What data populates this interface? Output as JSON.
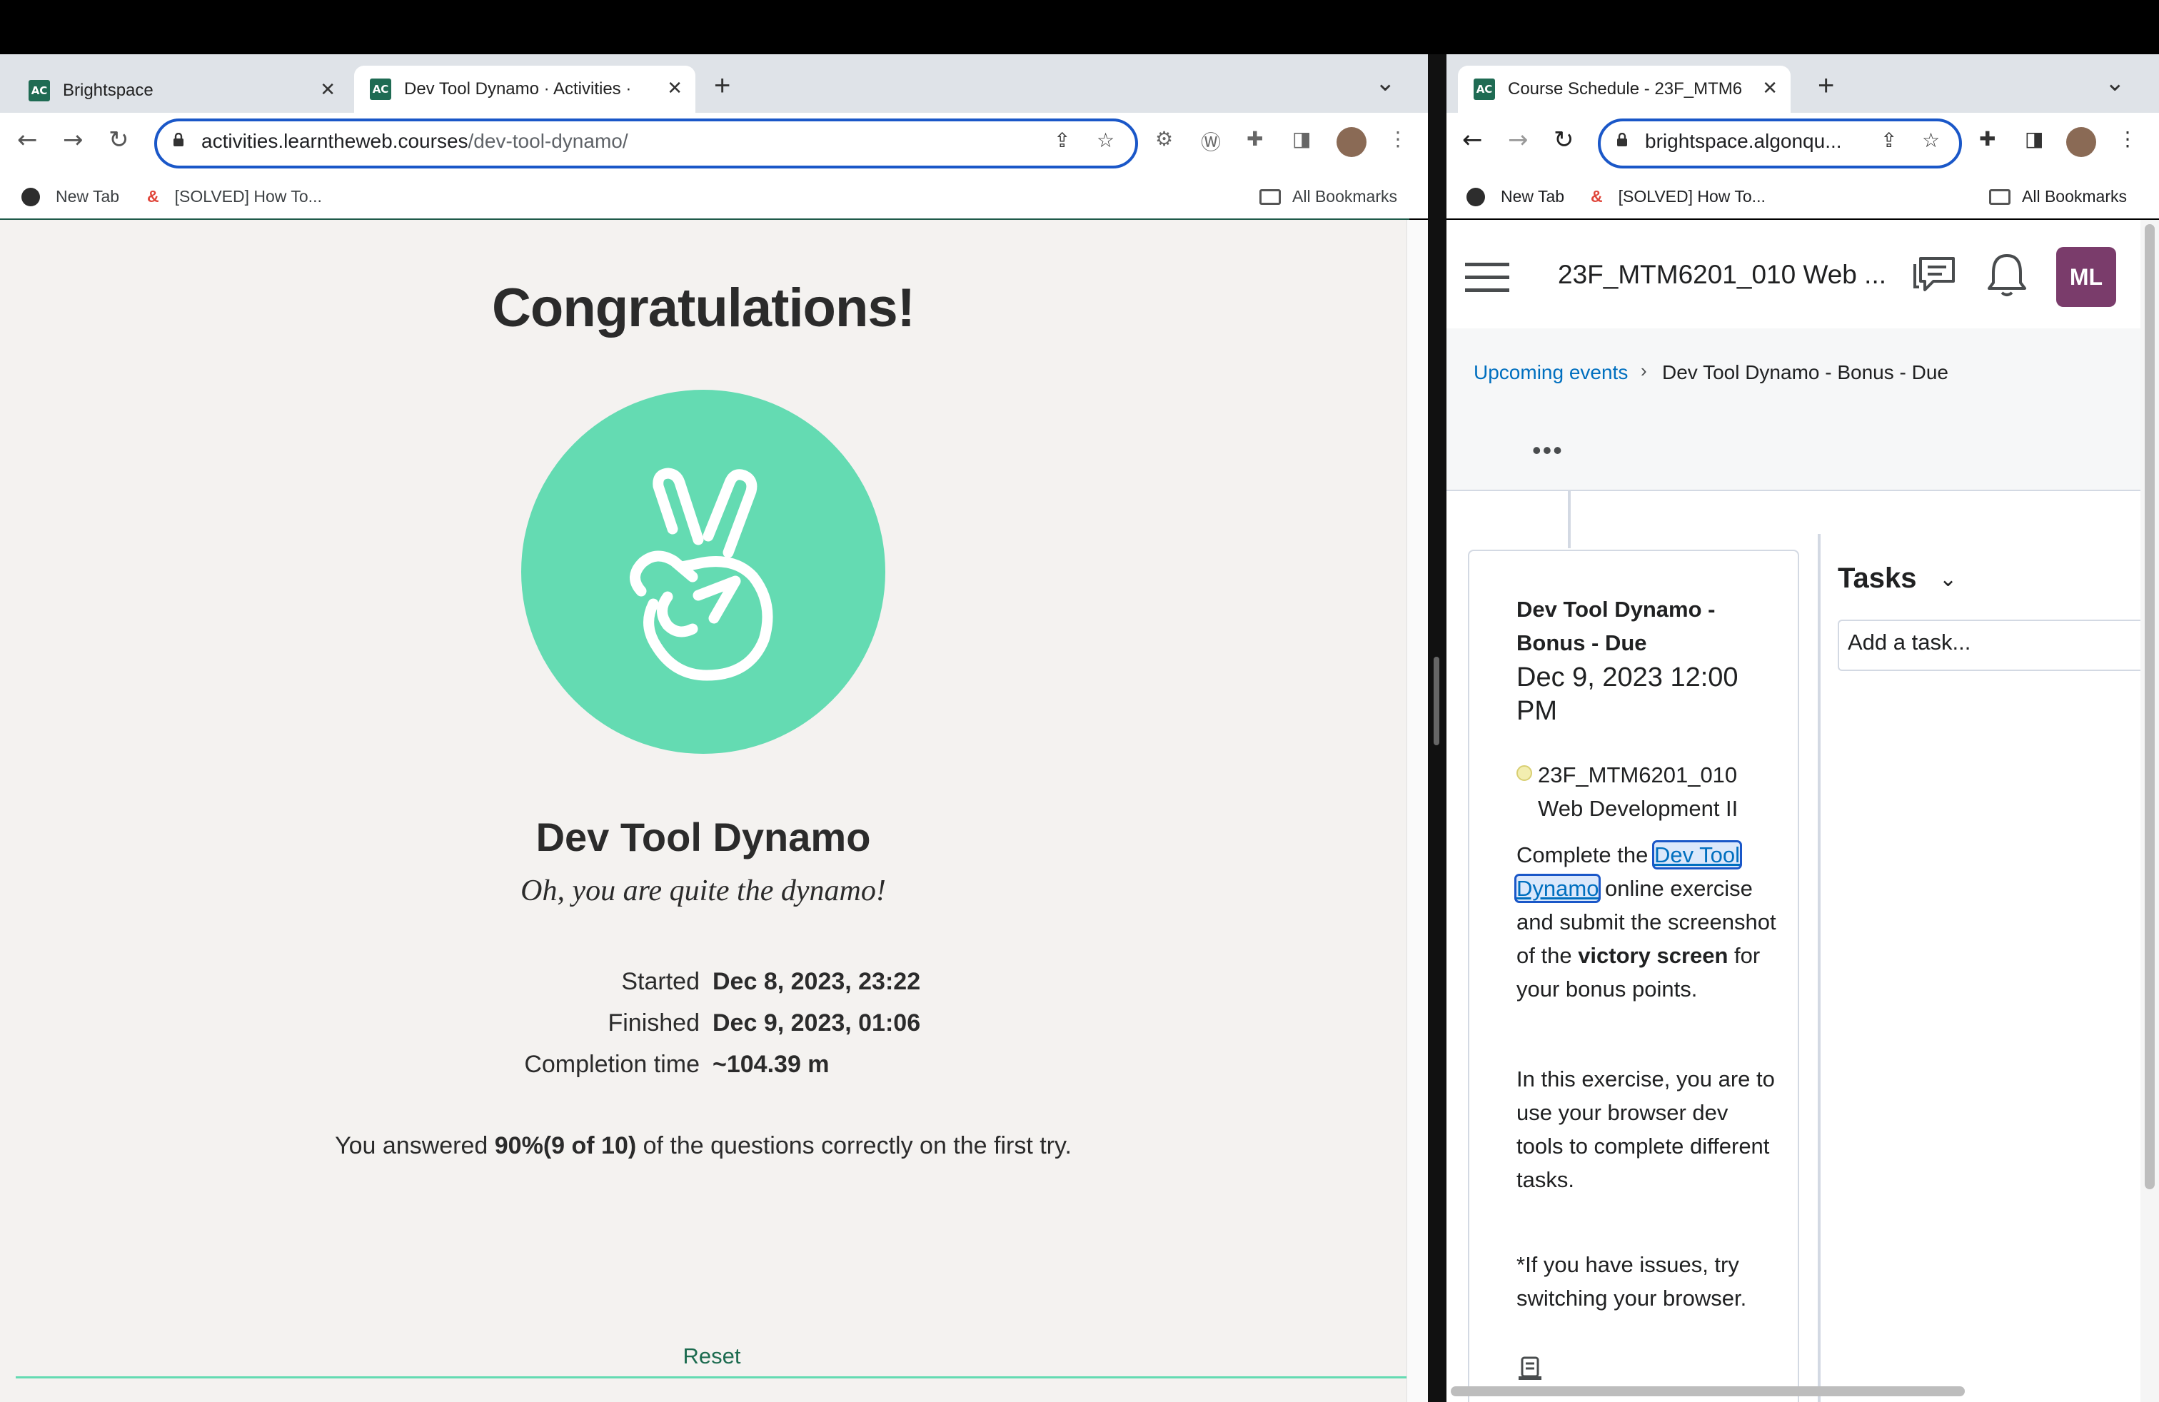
{
  "left_window": {
    "tabs": [
      {
        "label": "Brightspace",
        "active": false
      },
      {
        "label": "Dev Tool Dynamo · Activities ·",
        "active": true
      }
    ],
    "new_tab": "+",
    "tab_menu": "⌄",
    "url_domain": "activities.learntheweb.courses",
    "url_path": "/dev-tool-dynamo/",
    "bookmarks": [
      {
        "label": "New Tab",
        "icon": "globe-icon"
      },
      {
        "label": "[SOLVED] How To...",
        "icon": "solved-logo-icon"
      }
    ],
    "all_bookmarks": "All Bookmarks"
  },
  "page": {
    "congrats": "Congratulations!",
    "title": "Dev Tool Dynamo",
    "subtitle": "Oh, you are quite the dynamo!",
    "stats": [
      {
        "label": "Started",
        "value": "Dec 8, 2023, 23:22"
      },
      {
        "label": "Finished",
        "value": "Dec 9, 2023, 01:06"
      },
      {
        "label": "Completion time",
        "value": "~104.39 m"
      }
    ],
    "answered_pre": "You answered ",
    "answered_bold": "90%(9 of 10)",
    "answered_post": " of the questions correctly on the first try.",
    "reset": "Reset",
    "badge_color": "#64dbb2"
  },
  "right_window": {
    "tabs": [
      {
        "label": "Course Schedule - 23F_MTM6",
        "active": true
      }
    ],
    "new_tab": "+",
    "tab_menu": "⌄",
    "url": "brightspace.algonqu...",
    "bookmarks": [
      {
        "label": "New Tab",
        "icon": "globe-icon"
      },
      {
        "label": "[SOLVED] How To...",
        "icon": "solved-logo-icon"
      }
    ],
    "all_bookmarks": "All Bookmarks"
  },
  "brightspace": {
    "course_title": "23F_MTM6201_010 Web ...",
    "avatar_initials": "ML",
    "avatar_color": "#7a3c6b",
    "breadcrumb_link": "Upcoming events",
    "breadcrumb_current": "Dev Tool Dynamo - Bonus - Due",
    "more": "•••",
    "event": {
      "title": "Dev Tool Dynamo - Bonus - Due",
      "date": "Dec 9, 2023 12:00 PM",
      "course": "23F_MTM6201_010 Web Development II",
      "desc_pre": "Complete the ",
      "desc_link": "Dev Tool Dynamo",
      "desc_mid": " online exercise and submit the screenshot of the ",
      "desc_bold": "victory screen",
      "desc_post": " for your bonus points.",
      "para2": "In this exercise, you are to use your browser dev tools to complete different tasks.",
      "para3": "*If you have issues, try switching your browser."
    },
    "tasks_title": "Tasks",
    "task_placeholder": "Add a task..."
  }
}
